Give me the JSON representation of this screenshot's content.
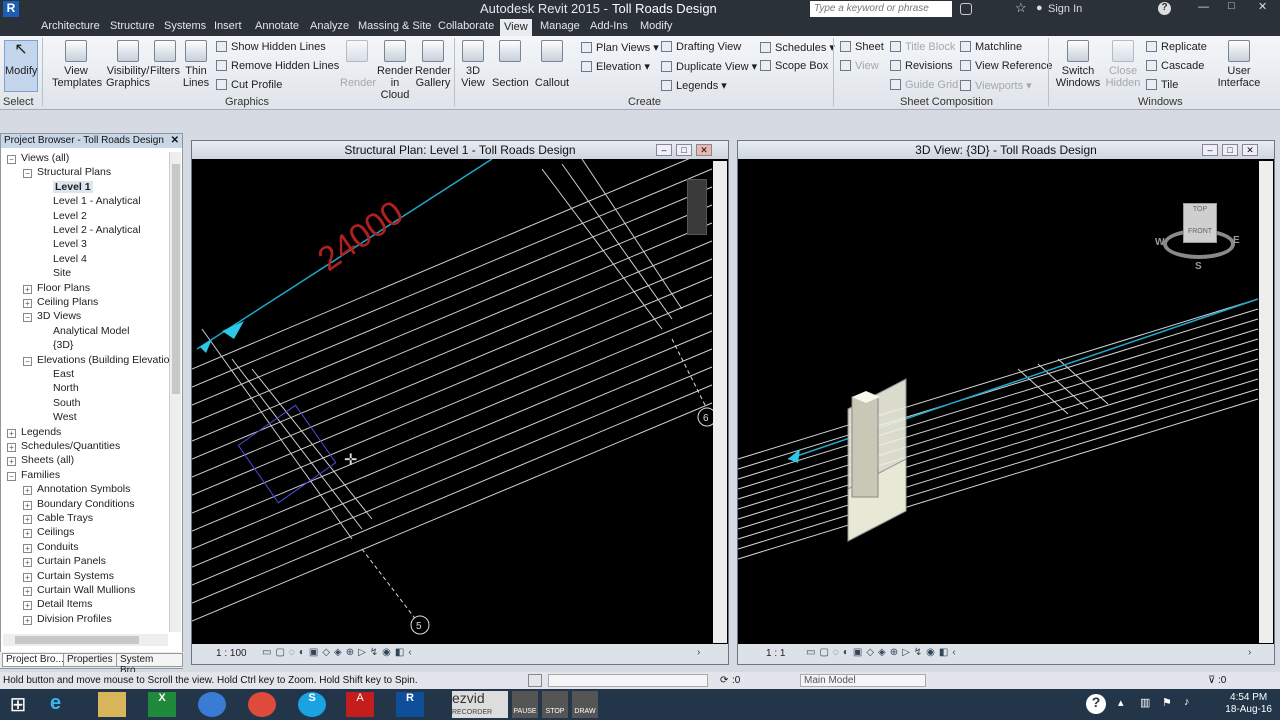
{
  "titlebar": {
    "app": "Autodesk Revit 2015 -",
    "project": "Toll Roads Design",
    "search_placeholder": "Type a keyword or phrase",
    "sign_in": "Sign In"
  },
  "tabs": [
    "Architecture",
    "Structure",
    "Systems",
    "Insert",
    "Annotate",
    "Analyze",
    "Massing & Site",
    "Collaborate",
    "View",
    "Manage",
    "Add-Ins",
    "Modify"
  ],
  "ribbon": {
    "modify": "Modify",
    "select": "Select",
    "view_templates": [
      "View",
      "Templates"
    ],
    "visgfx": [
      "Visibility/",
      "Graphics"
    ],
    "filters": "Filters",
    "thin": [
      "Thin",
      "Lines"
    ],
    "show_hidden": "Show  Hidden Lines",
    "remove_hidden": "Remove  Hidden Lines",
    "cut_profile": "Cut  Profile",
    "render": "Render",
    "render_cloud": [
      "Render",
      "in Cloud"
    ],
    "render_gallery": [
      "Render",
      "Gallery"
    ],
    "view3d": [
      "3D",
      "View"
    ],
    "section": "Section",
    "callout": "Callout",
    "plan_views": "Plan  Views",
    "elevation": "Elevation",
    "drafting": "Drafting  View",
    "duplicate": "Duplicate  View",
    "legends": "Legends",
    "schedules": "Schedules",
    "scope_box": "Scope  Box",
    "sheet": "Sheet",
    "view": "View",
    "title_block": "Title  Block",
    "revisions": "Revisions",
    "guide_grid": "Guide  Grid",
    "matchline": "Matchline",
    "view_ref": "View  Reference",
    "viewports": "Viewports",
    "switch_windows": [
      "Switch",
      "Windows"
    ],
    "close_hidden": [
      "Close",
      "Hidden"
    ],
    "replicate": "Replicate",
    "cascade": "Cascade",
    "tile": "Tile",
    "user_interface": [
      "User",
      "Interface"
    ],
    "groups": {
      "graphics": "Graphics",
      "create": "Create",
      "sheet_comp": "Sheet Composition",
      "windows": "Windows"
    }
  },
  "project_browser": {
    "title": "Project Browser - Toll Roads Design",
    "items": [
      "Views (all)",
      "Structural Plans",
      "Level 1",
      "Level 1 - Analytical",
      "Level 2",
      "Level 2 - Analytical",
      "Level 3",
      "Level 4",
      "Site",
      "Floor Plans",
      "Ceiling Plans",
      "3D Views",
      "Analytical Model",
      "{3D}",
      "Elevations (Building Elevation",
      "East",
      "North",
      "South",
      "West",
      "Legends",
      "Schedules/Quantities",
      "Sheets (all)",
      "Families",
      "Annotation Symbols",
      "Boundary Conditions",
      "Cable Trays",
      "Ceilings",
      "Conduits",
      "Curtain Panels",
      "Curtain Systems",
      "Curtain Wall Mullions",
      "Detail Items",
      "Division Profiles"
    ],
    "tabs": [
      "Project Bro...",
      "Properties",
      "System Bro..."
    ]
  },
  "view1": {
    "title": "Structural Plan: Level 1 - Toll Roads Design",
    "scale": "1 : 100",
    "dim": "24000",
    "grid5": "5",
    "grid6": "6"
  },
  "view2": {
    "title": "3D View: {3D} - Toll Roads Design",
    "scale": "1 : 1"
  },
  "viewcube": {
    "top": "TOP",
    "front": "FRONT",
    "w": "W",
    "e": "E",
    "s": "S"
  },
  "status": {
    "message": "Hold button and move mouse to Scroll the view. Hold Ctrl key to Zoom. Hold Shift key to Spin.",
    "zero": ":0",
    "model": "Main Model",
    "filter": ":0"
  },
  "taskbar": {
    "ezvid": "ezvid",
    "recorder": "RECORDER",
    "pause": "PAUSE",
    "stop": "STOP",
    "draw": "DRAW",
    "time": "4:54 PM",
    "date": "18-Aug-16"
  }
}
